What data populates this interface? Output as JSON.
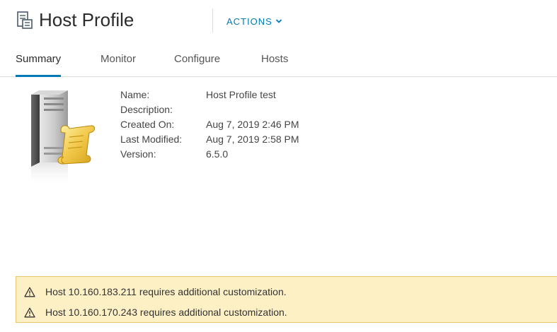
{
  "header": {
    "title": "Host Profile",
    "title_icon": "host-profile-icon",
    "actions_label": "ACTIONS",
    "actions_icon": "chevron-down-icon",
    "accent_color": "#0079b8"
  },
  "tabs": [
    {
      "label": "Summary",
      "active": true
    },
    {
      "label": "Monitor",
      "active": false
    },
    {
      "label": "Configure",
      "active": false
    },
    {
      "label": "Hosts",
      "active": false
    }
  ],
  "summary": {
    "image_icon": "host-profile-server-icon",
    "properties": [
      {
        "label": "Name:",
        "value": "Host Profile test"
      },
      {
        "label": "Description:",
        "value": ""
      },
      {
        "label": "Created On:",
        "value": "Aug 7, 2019 2:46 PM"
      },
      {
        "label": "Last Modified:",
        "value": "Aug 7, 2019 2:58 PM"
      },
      {
        "label": "Version:",
        "value": "6.5.0"
      }
    ]
  },
  "alerts": {
    "icon": "warning-icon",
    "background_color": "#fdf0c5",
    "items": [
      "Host 10.160.183.211 requires additional customization.",
      "Host 10.160.170.243 requires additional customization."
    ]
  }
}
